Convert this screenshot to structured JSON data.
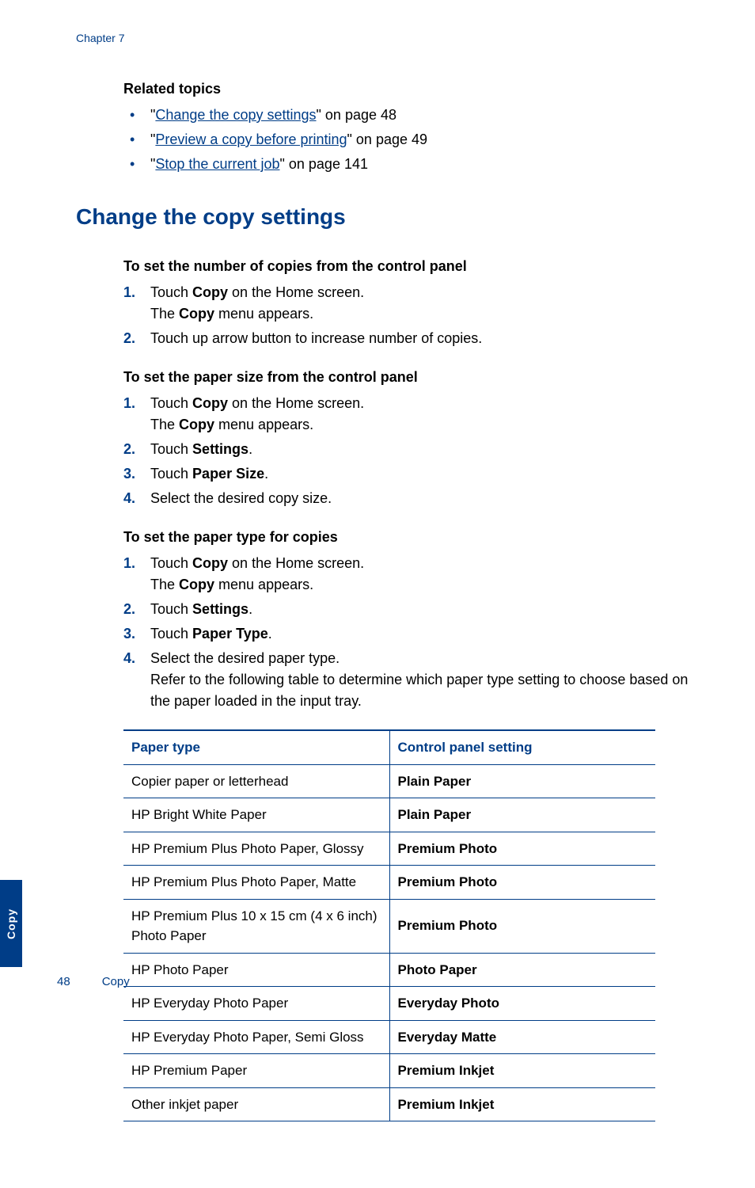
{
  "chapter": "Chapter 7",
  "relatedTopics": {
    "heading": "Related topics",
    "items": [
      {
        "link": "Change the copy settings",
        "suffix": "\" on page 48"
      },
      {
        "link": "Preview a copy before printing",
        "suffix": "\" on page 49"
      },
      {
        "link": "Stop the current job",
        "suffix": "\" on page 141"
      }
    ]
  },
  "mainHeading": "Change the copy settings",
  "sections": [
    {
      "heading": "To set the number of copies from the control panel",
      "steps": [
        {
          "num": "1.",
          "prefix": "Touch ",
          "bold": "Copy",
          "suffix": " on the Home screen.",
          "sub_prefix": "The ",
          "sub_bold": "Copy",
          "sub_suffix": " menu appears."
        },
        {
          "num": "2.",
          "prefix": "Touch up arrow button to increase number of copies.",
          "bold": "",
          "suffix": ""
        }
      ]
    },
    {
      "heading": "To set the paper size from the control panel",
      "steps": [
        {
          "num": "1.",
          "prefix": "Touch ",
          "bold": "Copy",
          "suffix": " on the Home screen.",
          "sub_prefix": "The ",
          "sub_bold": "Copy",
          "sub_suffix": " menu appears."
        },
        {
          "num": "2.",
          "prefix": "Touch ",
          "bold": "Settings",
          "suffix": "."
        },
        {
          "num": "3.",
          "prefix": "Touch ",
          "bold": "Paper Size",
          "suffix": "."
        },
        {
          "num": "4.",
          "prefix": "Select the desired copy size.",
          "bold": "",
          "suffix": ""
        }
      ]
    },
    {
      "heading": "To set the paper type for copies",
      "steps": [
        {
          "num": "1.",
          "prefix": "Touch ",
          "bold": "Copy",
          "suffix": " on the Home screen.",
          "sub_prefix": "The ",
          "sub_bold": "Copy",
          "sub_suffix": " menu appears."
        },
        {
          "num": "2.",
          "prefix": "Touch ",
          "bold": "Settings",
          "suffix": "."
        },
        {
          "num": "3.",
          "prefix": "Touch ",
          "bold": "Paper Type",
          "suffix": "."
        },
        {
          "num": "4.",
          "prefix": "Select the desired paper type.",
          "bold": "",
          "suffix": "",
          "tail": "Refer to the following table to determine which paper type setting to choose based on the paper loaded in the input tray."
        }
      ]
    }
  ],
  "table": {
    "headers": [
      "Paper type",
      "Control panel setting"
    ],
    "rows": [
      [
        "Copier paper or letterhead",
        "Plain Paper"
      ],
      [
        "HP Bright White Paper",
        "Plain Paper"
      ],
      [
        "HP Premium Plus Photo Paper, Glossy",
        "Premium Photo"
      ],
      [
        "HP Premium Plus Photo Paper, Matte",
        "Premium Photo"
      ],
      [
        "HP Premium Plus 10 x 15 cm (4 x 6 inch) Photo Paper",
        "Premium Photo"
      ],
      [
        "HP Photo Paper",
        "Photo Paper"
      ],
      [
        "HP Everyday Photo Paper",
        "Everyday Photo"
      ],
      [
        "HP Everyday Photo Paper, Semi Gloss",
        "Everyday Matte"
      ],
      [
        "HP Premium Paper",
        "Premium Inkjet"
      ],
      [
        "Other inkjet paper",
        "Premium Inkjet"
      ]
    ]
  },
  "sideTab": "Copy",
  "footer": {
    "page": "48",
    "section": "Copy"
  }
}
